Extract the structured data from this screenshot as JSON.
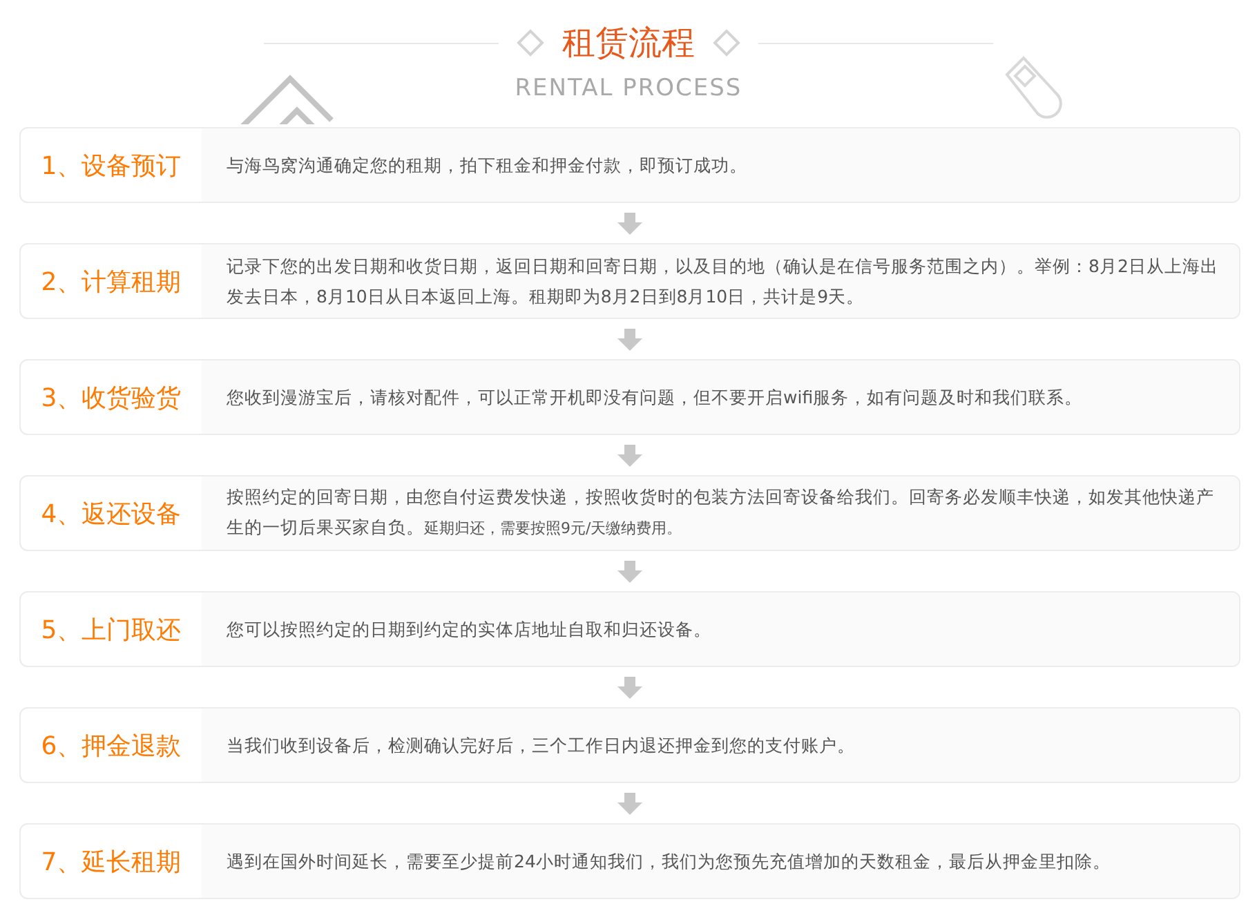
{
  "header": {
    "title": "租赁流程",
    "subtitle": "RENTAL PROCESS"
  },
  "steps": [
    {
      "label": "1、设备预订",
      "description": "与海鸟窝沟通确定您的租期，拍下租金和押金付款，即预订成功。"
    },
    {
      "label": "2、计算租期",
      "description": "记录下您的出发日期和收货日期，返回日期和回寄日期，以及目的地（确认是在信号服务范围之内）。举例：8月2日从上海出发去日本，8月10日从日本返回上海。租期即为8月2日到8月10日，共计是9天。"
    },
    {
      "label": "3、收货验货",
      "description": "您收到漫游宝后，请核对配件，可以正常开机即没有问题，但不要开启wifi服务，如有问题及时和我们联系。"
    },
    {
      "label": "4、返还设备",
      "description": "按照约定的回寄日期，由您自付运费发快递，按照收货时的包装方法回寄设备给我们。回寄务必发顺丰快递，如发其他快递产生的一切后果买家自负。",
      "note": "延期归还，需要按照9元/天缴纳费用。"
    },
    {
      "label": "5、上门取还",
      "description": "您可以按照约定的日期到约定的实体店地址自取和归还设备。"
    },
    {
      "label": "6、押金退款",
      "description": "当我们收到设备后，检测确认完好后，三个工作日内退还押金到您的支付账户。"
    },
    {
      "label": "7、延长租期",
      "description": "遇到在国外时间延长，需要至少提前24小时通知我们，我们为您预先充值增加的天数租金，最后从押金里扣除。"
    }
  ]
}
